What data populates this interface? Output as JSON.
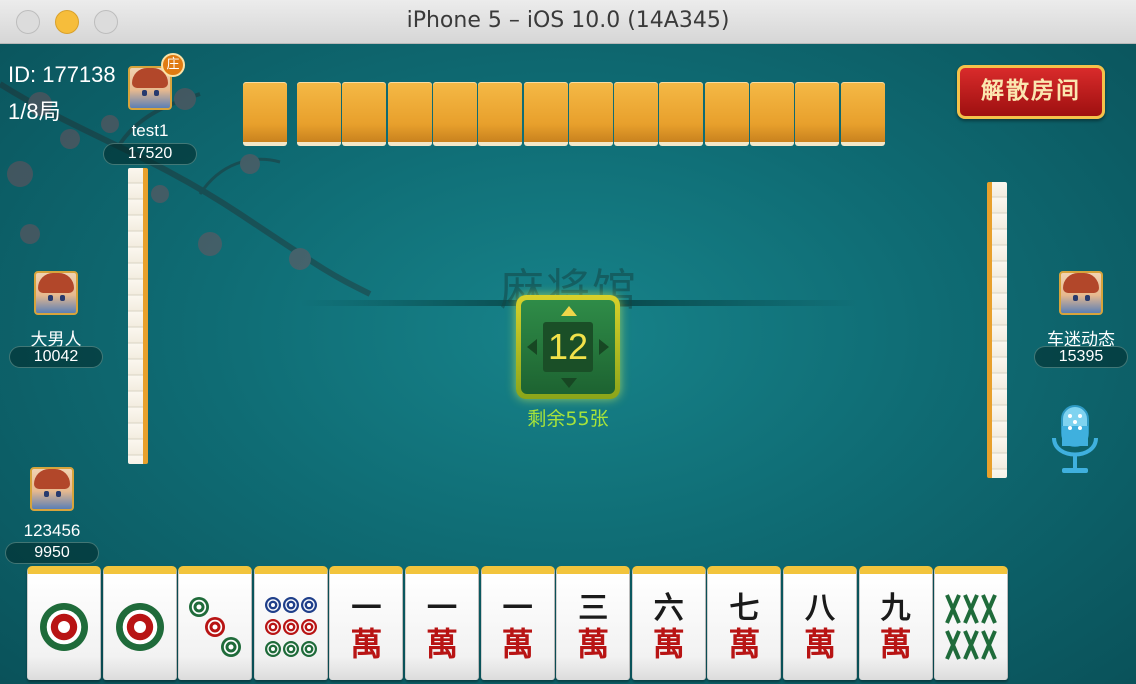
{
  "window": {
    "title": "iPhone 5 – iOS 10.0 (14A345)"
  },
  "room": {
    "id_label": "ID: 177138",
    "round": "1/8局"
  },
  "buttons": {
    "dissolve": "解散房间"
  },
  "players": {
    "top": {
      "name": "test1",
      "score": "17520",
      "dealer_badge": "庄"
    },
    "left": {
      "name": "大男人",
      "score": "10042"
    },
    "right": {
      "name": "车迷动态",
      "score": "15395"
    },
    "self": {
      "name": "123456",
      "score": "9950"
    }
  },
  "center": {
    "count": "12",
    "remaining_text": "剩余55张"
  },
  "watermark": {
    "logo": "麻将馆"
  },
  "hand": [
    {
      "suit": "circle",
      "rank": 1,
      "icon": "one-circle-tile"
    },
    {
      "suit": "circle",
      "rank": 1,
      "icon": "one-circle-tile"
    },
    {
      "suit": "circle",
      "rank": 3,
      "icon": "three-circle-tile"
    },
    {
      "suit": "circle",
      "rank": 9,
      "icon": "nine-circle-tile"
    },
    {
      "suit": "character",
      "top": "一",
      "bottom": "萬"
    },
    {
      "suit": "character",
      "top": "一",
      "bottom": "萬"
    },
    {
      "suit": "character",
      "top": "一",
      "bottom": "萬"
    },
    {
      "suit": "character",
      "top": "三",
      "bottom": "萬"
    },
    {
      "suit": "character",
      "top": "六",
      "bottom": "萬"
    },
    {
      "suit": "character",
      "top": "七",
      "bottom": "萬"
    },
    {
      "suit": "character",
      "top": "八",
      "bottom": "萬"
    },
    {
      "suit": "character",
      "top": "九",
      "bottom": "萬"
    },
    {
      "suit": "bamboo",
      "rank": 6,
      "icon": "six-bamboo-tile"
    }
  ],
  "colors": {
    "table": "#0f6c74",
    "tile_back": "#e8a02c",
    "character_red": "#b81414",
    "compass_count": "#f1e24a",
    "remaining_green": "#a7e33a"
  }
}
